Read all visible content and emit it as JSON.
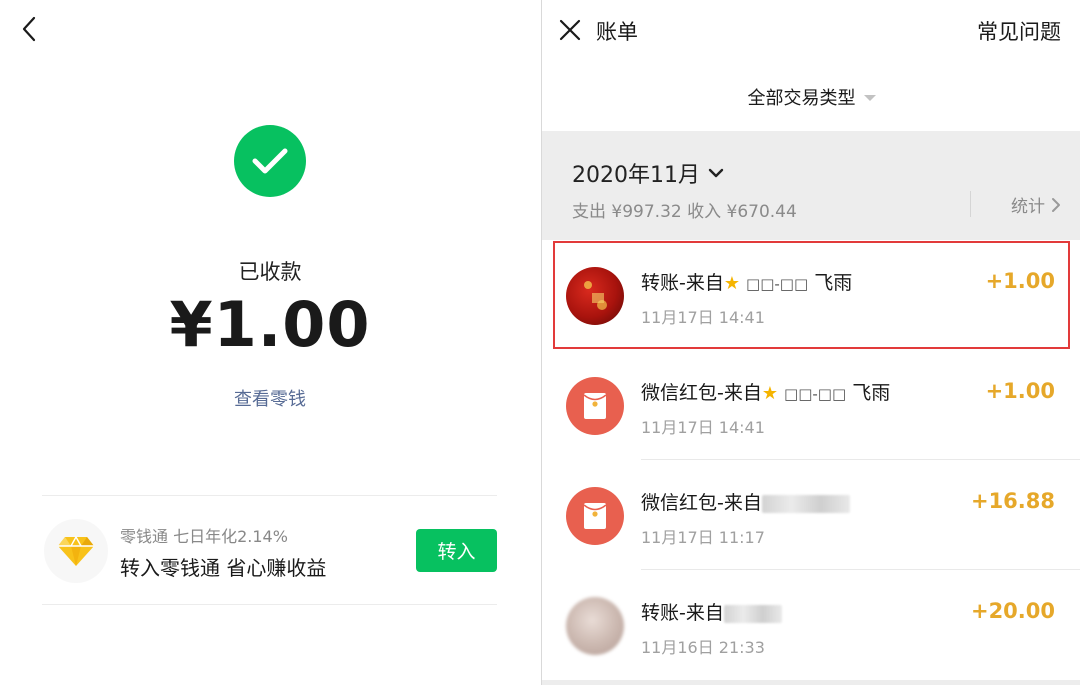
{
  "left": {
    "status_label": "已收款",
    "amount": "¥1.00",
    "view_change_link": "查看零钱",
    "lingqiantong": {
      "subtitle": "零钱通 七日年化2.14%",
      "title": "转入零钱通 省心赚收益",
      "button_label": "转入"
    }
  },
  "right": {
    "header": {
      "title": "账单",
      "faq": "常见问题",
      "filter": "全部交易类型"
    },
    "month": {
      "label": "2020年11月",
      "summary": "支出 ¥997.32 收入 ¥670.44",
      "stats_label": "统计"
    },
    "transactions": [
      {
        "title_prefix": "转账-来自",
        "name": "飞雨",
        "masked": "□□-□□",
        "time": "11月17日 14:41",
        "amount": "+1.00"
      },
      {
        "title_prefix": "微信红包-来自",
        "name": "飞雨",
        "masked": "□□-□□",
        "time": "11月17日 14:41",
        "amount": "+1.00"
      },
      {
        "title_prefix": "微信红包-来自",
        "time": "11月17日 11:17",
        "amount": "+16.88"
      },
      {
        "title_prefix": "转账-来自",
        "time": "11月16日 21:33",
        "amount": "+20.00"
      }
    ]
  },
  "colors": {
    "wechat_green": "#07c160",
    "link_blue": "#576b95",
    "amount_gold": "#e6a82a",
    "highlight_red": "#e23a3a",
    "red_packet": "#e8604f"
  },
  "icons": [
    "back-chevron-icon",
    "check-icon",
    "diamond-icon",
    "close-icon",
    "caret-down-icon",
    "chevron-down-icon",
    "chevron-right-icon",
    "red-packet-icon",
    "star-icon"
  ]
}
